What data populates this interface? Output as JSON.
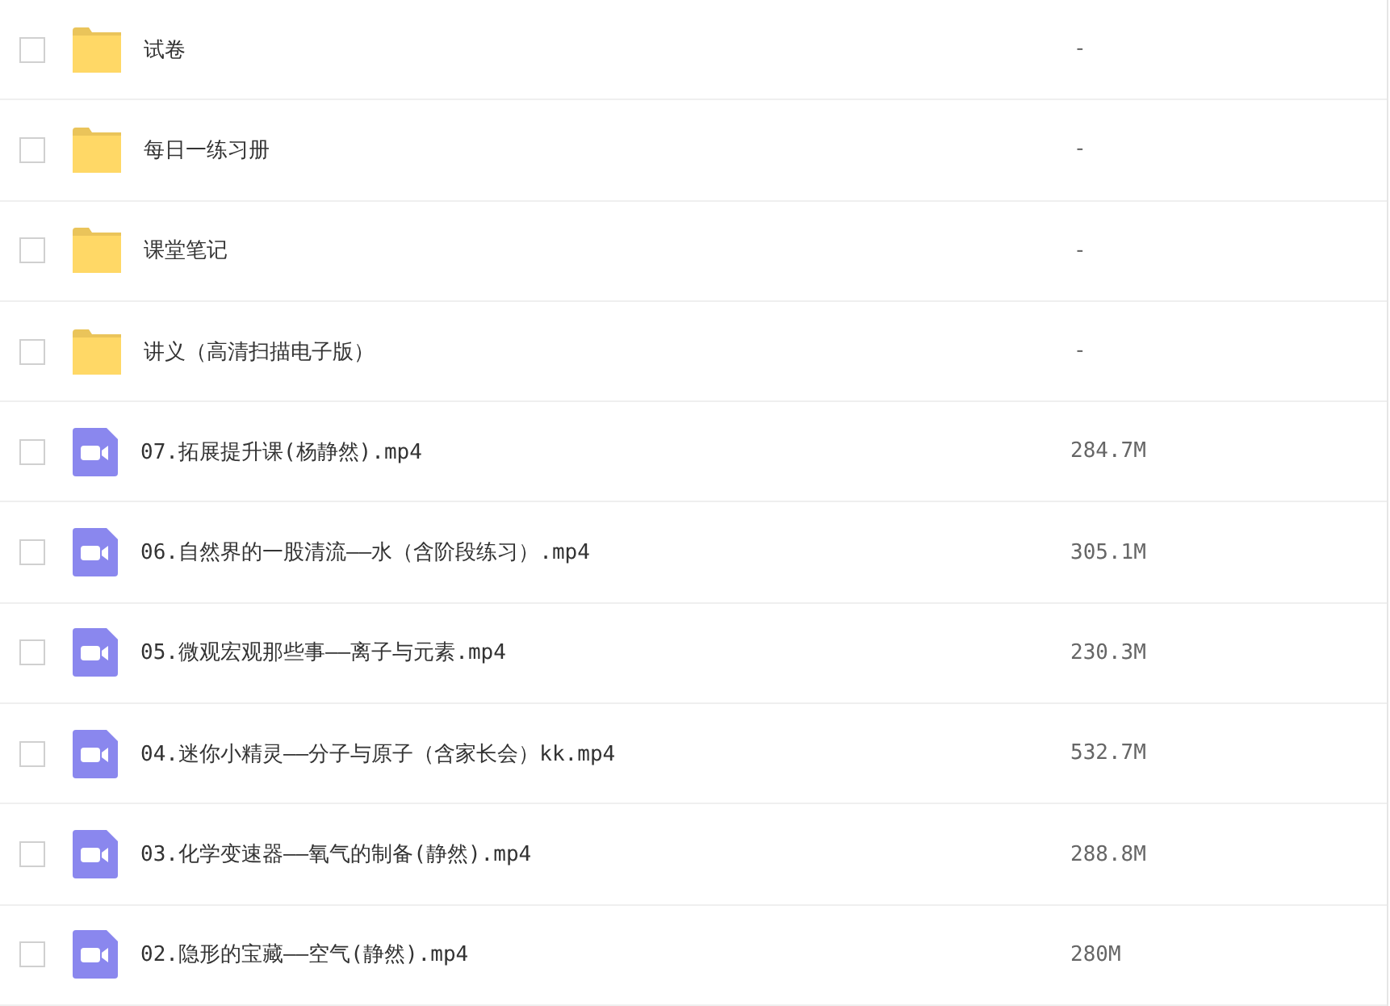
{
  "files": [
    {
      "kind": "folder",
      "name": "试卷",
      "size": "-",
      "checked": false
    },
    {
      "kind": "folder",
      "name": "每日一练习册",
      "size": "-",
      "checked": false
    },
    {
      "kind": "folder",
      "name": "课堂笔记",
      "size": "-",
      "checked": false
    },
    {
      "kind": "folder",
      "name": "讲义（高清扫描电子版）",
      "size": "-",
      "checked": false
    },
    {
      "kind": "video",
      "name": "07.拓展提升课(杨静然).mp4",
      "size": "284.7M",
      "checked": false
    },
    {
      "kind": "video",
      "name": "06.自然界的一股清流——水（含阶段练习）.mp4",
      "size": "305.1M",
      "checked": false
    },
    {
      "kind": "video",
      "name": "05.微观宏观那些事——离子与元素.mp4",
      "size": "230.3M",
      "checked": false
    },
    {
      "kind": "video",
      "name": "04.迷你小精灵——分子与原子（含家长会）kk.mp4",
      "size": "532.7M",
      "checked": false
    },
    {
      "kind": "video",
      "name": "03.化学变速器——氧气的制备(静然).mp4",
      "size": "288.8M",
      "checked": false
    },
    {
      "kind": "video",
      "name": "02.隐形的宝藏——空气(静然).mp4",
      "size": "280M",
      "checked": false
    }
  ]
}
